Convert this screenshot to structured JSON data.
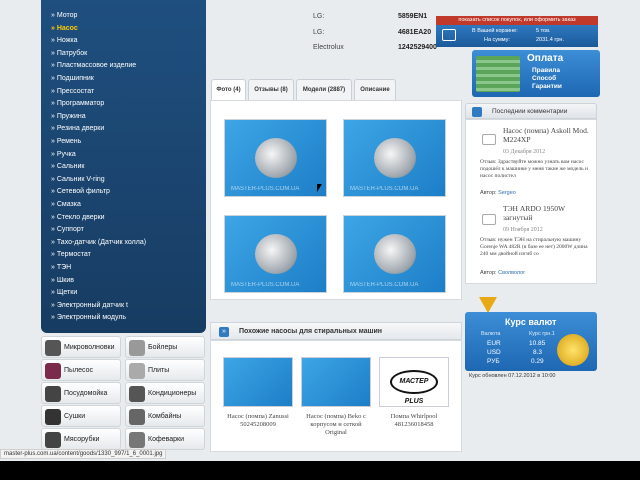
{
  "sidebar": {
    "categories": [
      {
        "label": "» Мотор"
      },
      {
        "label": "» Насос",
        "active": true
      },
      {
        "label": "» Ножка"
      },
      {
        "label": "» Патрубок"
      },
      {
        "label": "» Пластмассовое изделие"
      },
      {
        "label": "» Подшипник"
      },
      {
        "label": "» Прессостат"
      },
      {
        "label": "» Программатор"
      },
      {
        "label": "» Пружина"
      },
      {
        "label": "» Резина дверки"
      },
      {
        "label": "» Ремень"
      },
      {
        "label": "» Ручка"
      },
      {
        "label": "» Сальник"
      },
      {
        "label": "» Сальник V-ring"
      },
      {
        "label": "» Сетевой фильтр"
      },
      {
        "label": "» Смазка"
      },
      {
        "label": "» Стекло дверки"
      },
      {
        "label": "» Суппорт"
      },
      {
        "label": "» Тахо-датчик (Датчик холла)"
      },
      {
        "label": "» Термостат"
      },
      {
        "label": "» ТЭН"
      },
      {
        "label": "» Шкив"
      },
      {
        "label": "» Щетки"
      },
      {
        "label": "» Электронный датчик t"
      },
      {
        "label": "» Электронный модуль"
      }
    ],
    "tiles": [
      {
        "label": "Микроволновки",
        "icon": "microwave-icon"
      },
      {
        "label": "Бойлеры",
        "icon": "boiler-icon"
      },
      {
        "label": "Пылесос",
        "icon": "vacuum-icon"
      },
      {
        "label": "Плиты",
        "icon": "stove-icon"
      },
      {
        "label": "Посудомойка",
        "icon": "dishwasher-icon"
      },
      {
        "label": "Кондиционеры",
        "icon": "air-conditioner-icon"
      },
      {
        "label": "Сушки",
        "icon": "dryer-icon"
      },
      {
        "label": "Комбайны",
        "icon": "food-processor-icon"
      },
      {
        "label": "Мясорубки",
        "icon": "meat-grinder-icon"
      },
      {
        "label": "Кофеварки",
        "icon": "coffee-maker-icon"
      }
    ]
  },
  "specs": [
    {
      "brand": "LG:",
      "code": "5859EN1"
    },
    {
      "brand": "LG:",
      "code": "4681EA20"
    },
    {
      "brand": "Electrolux",
      "code": "1242529400"
    }
  ],
  "tabs": [
    {
      "label": "Фото (4)",
      "selected": true
    },
    {
      "label": "Отзывы (8)"
    },
    {
      "label": "Модели (2887)"
    },
    {
      "label": "Описание"
    }
  ],
  "photos": {
    "watermark": "MASTER-PLUS.COM.UA"
  },
  "similar": {
    "title": "Похожие насосы для стиральных машин",
    "items": [
      {
        "caption": "Насос (помпа) Zanussi 50245208009"
      },
      {
        "caption": "Насос (помпа) Beko с корпусом и сеткой Original"
      },
      {
        "caption": "Помпа Whirlpool 481236018458",
        "logo": "МАСТЕР PLUS"
      }
    ]
  },
  "cart": {
    "bar_text": "показать список покупок, или оформить заказ",
    "in_cart_label": "В Вашей корзине:",
    "in_cart_value": "5 тов.",
    "sum_label": "На сумму:",
    "sum_value": "2031.4 грн."
  },
  "payment": {
    "title": "Оплата",
    "lines": [
      "Правила",
      "Способ",
      "Гарантии"
    ]
  },
  "comments": {
    "title": "Последнии комментарии",
    "items": [
      {
        "product": "Насос (помпа) Askoll Mod. M224XP",
        "date": "03 Декабря 2012",
        "text_label": "Отзыв:",
        "text": "Здраствуйте можно узнать вам насос подошёл к машинке у меня такие же модель и насос полистел",
        "author_label": "Автор:",
        "author": "Sergeo"
      },
      {
        "product": "ТЭН ARDO 1950W загнутый",
        "date": "09 Ноября 2012",
        "text_label": "Отзыв:",
        "text": "нужен ТЭН на стиральную машину Gorenje WA 482R (в базе ее нет) 2000W длина 240 мм двойной изгиб со",
        "author_label": "Автор:",
        "author": "Сволволог"
      }
    ]
  },
  "currency": {
    "title": "Курс валют",
    "header": [
      "Валюта",
      "Курс грн.1"
    ],
    "rows": [
      {
        "code": "EUR",
        "rate": "10.85"
      },
      {
        "code": "USD",
        "rate": "8.3"
      },
      {
        "code": "РУБ",
        "rate": "0.29"
      }
    ],
    "updated": "Курс обновлен 07.12.2012 в 10:00"
  },
  "statusbar": {
    "url": "master-plus.com.ua/content/goods/1330_997/1_6_0001.jpg"
  }
}
